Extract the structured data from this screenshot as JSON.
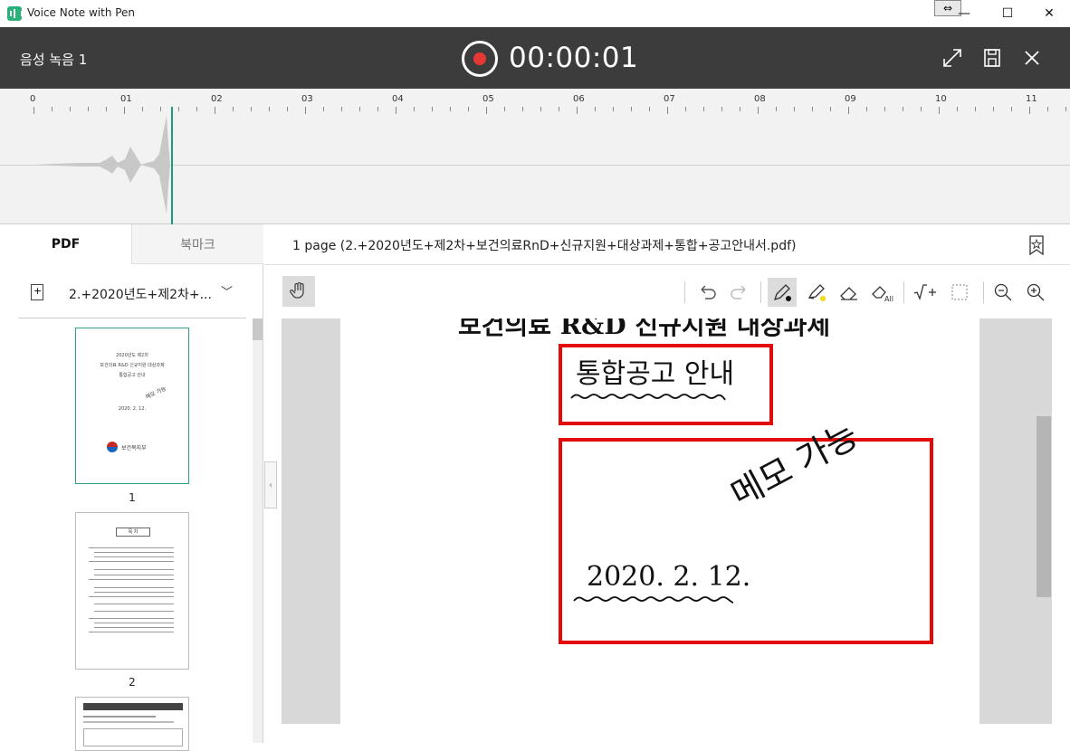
{
  "app": {
    "title": "Voice Note with Pen",
    "snap_glyph": "⇔",
    "minimize": "—",
    "maximize": "☐",
    "close": "✕"
  },
  "recording": {
    "name": "음성 녹음 1",
    "time": "00:00:01"
  },
  "timeline": {
    "ticks": [
      "0",
      "01",
      "02",
      "03",
      "04",
      "05",
      "06",
      "07",
      "08",
      "09",
      "10",
      "11"
    ]
  },
  "left_panel": {
    "tabs": [
      "PDF",
      "북마크"
    ],
    "file_name": "2.+2020년도+제2차+...",
    "pages": [
      "1",
      "2"
    ],
    "thumb1": {
      "line1": "2020년도 제2차",
      "line2": "보건의료 R&D 신규지원 대상과제",
      "line3": "통합공고 안내",
      "date": "2020. 2. 12.",
      "handwriting": "메모 가능",
      "logo": "보건복지부"
    },
    "thumb2": {
      "title": "목 차"
    }
  },
  "right_panel": {
    "page_title": "1 page (2.+2020년도+제2차+보건의료RnD+신규지원+대상과제+통합+공고안내서.pdf)",
    "doc": {
      "heading_cut": "보건의료 R&D 신규지원 대상과제",
      "subtitle": "통합공고 안내",
      "date": "2020.  2.  12.",
      "handwriting": "메모 가능"
    }
  },
  "colors": {
    "accent": "#1a9e7a",
    "record": "#e53935",
    "annotation_red": "#e30a0a",
    "header_dark": "#3c3c3c"
  }
}
